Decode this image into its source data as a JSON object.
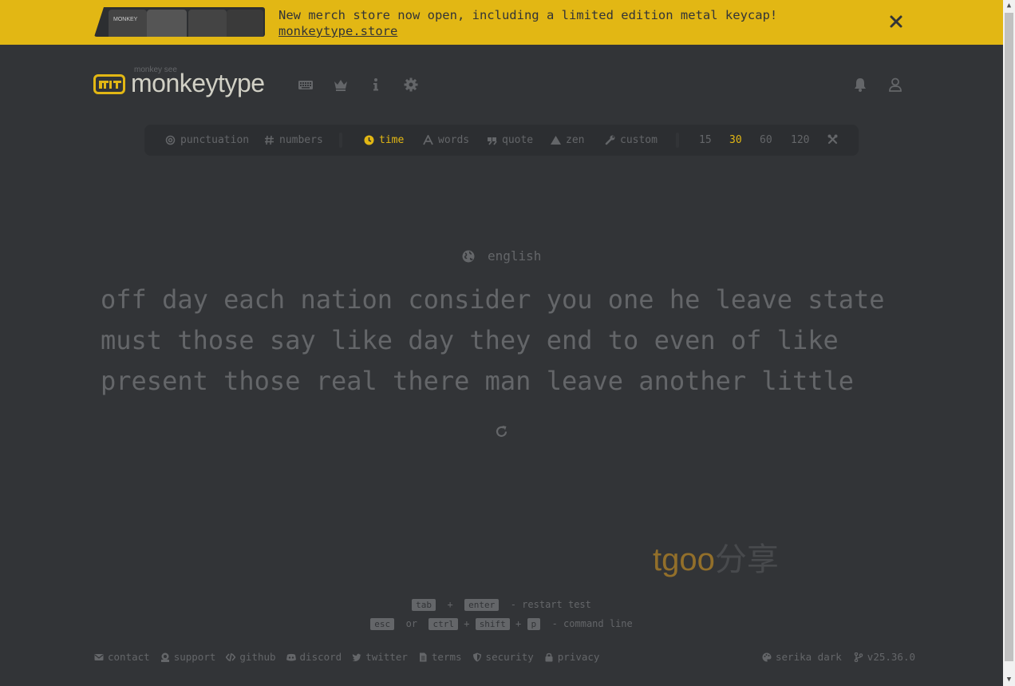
{
  "banner": {
    "message": "New merch store now open, including a limited edition metal keycap!",
    "link": "monkeytype.store",
    "merch_text": "MONKEY"
  },
  "header": {
    "logo_sub": "monkey see",
    "logo_text": "monkeytype"
  },
  "modes": {
    "punctuation": "punctuation",
    "numbers": "numbers",
    "time": "time",
    "words": "words",
    "quote": "quote",
    "zen": "zen",
    "custom": "custom",
    "durations": [
      "15",
      "30",
      "60",
      "120"
    ],
    "active_duration": "30"
  },
  "test": {
    "language": "english",
    "lines": [
      "off day each nation consider you one he leave state",
      "must those say like day they end to even of like",
      "present those real there man leave another little"
    ]
  },
  "watermark": {
    "latin": "tgoo",
    "cjk": "分享"
  },
  "keytips": {
    "tab": "tab",
    "plus": "+",
    "enter": "enter",
    "restart": "- restart test",
    "esc": "esc",
    "or": "or",
    "ctrl": "ctrl",
    "shift": "shift",
    "p": "p",
    "command": "- command line"
  },
  "footer": {
    "links": [
      "contact",
      "support",
      "github",
      "discord",
      "twitter",
      "terms",
      "security",
      "privacy"
    ],
    "theme": "serika dark",
    "version": "v25.36.0"
  },
  "colors": {
    "bg": "#323437",
    "accent": "#e2b714",
    "sub": "#646669",
    "text": "#d1d0c5",
    "sub_alt": "#2c2e31"
  }
}
